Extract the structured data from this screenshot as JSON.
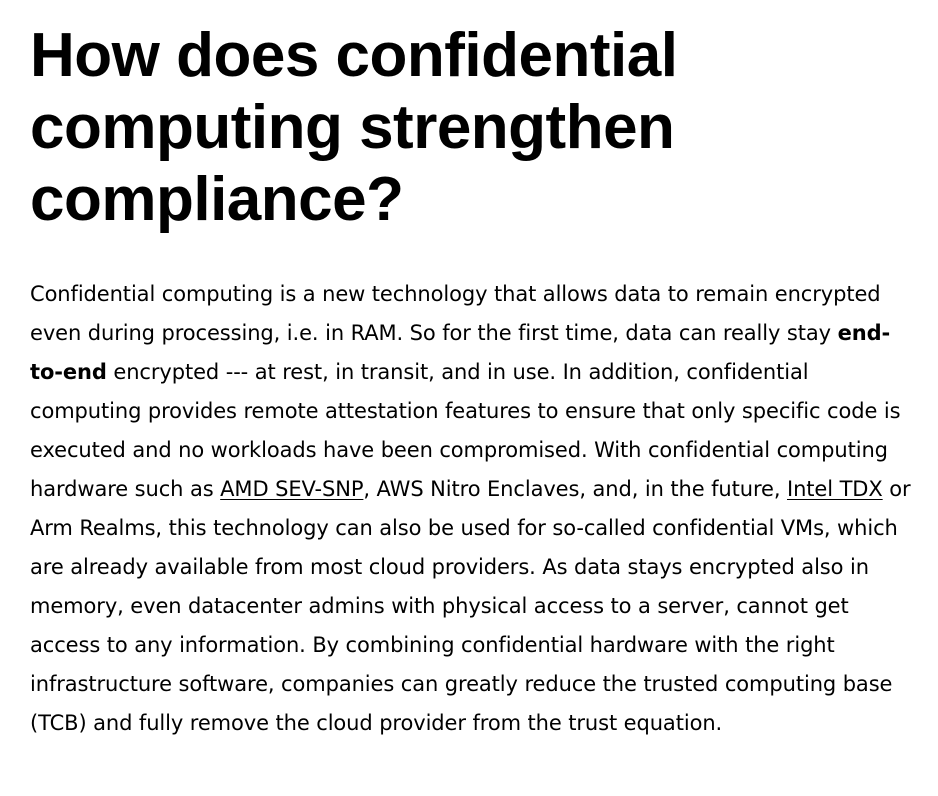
{
  "article": {
    "heading": "How does confidential computing strengthen compliance?",
    "paragraph": {
      "part1": "Confidential computing is a new technology that allows data to remain encrypted even during processing, i.e. in RAM. So for the first time, data can really stay ",
      "bold": "end-to-end",
      "part2": " encrypted --- at rest, in transit, and in use. In addition, confidential computing provides remote attestation features to ensure that only specific code is executed and no workloads have been compromised. With confidential computing hardware such as ",
      "link1": "AMD SEV-SNP",
      "part3": ", AWS Nitro Enclaves, and, in the future, ",
      "link2": "Intel TDX",
      "part4": " or Arm Realms, this technology can also be used for so-called confidential VMs, which are already available from most cloud providers. As data stays encrypted also in memory, even datacenter admins with physical access to a server, cannot get access to any information. By combining confidential hardware with the right infrastructure software, companies can greatly reduce the trusted computing base (TCB) and fully remove the cloud provider from the trust equation."
    }
  }
}
